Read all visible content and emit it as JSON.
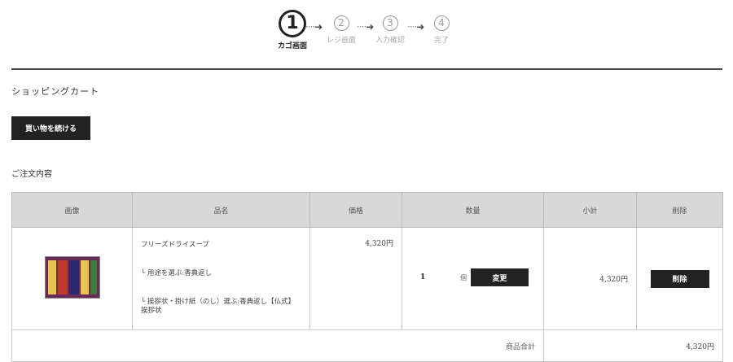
{
  "steps": [
    {
      "num": "1",
      "label": "カゴ画面"
    },
    {
      "num": "2",
      "label": "レジ画面"
    },
    {
      "num": "3",
      "label": "入力確認"
    },
    {
      "num": "4",
      "label": "完了"
    }
  ],
  "cart": {
    "heading": "ショッピングカート",
    "continue_label": "買い物を続ける",
    "order_heading": "ご注文内容"
  },
  "table": {
    "headers": [
      "画像",
      "品名",
      "価格",
      "数量",
      "小計",
      "削除"
    ],
    "rows": [
      {
        "name": "フリーズドライスープ",
        "option1": "└ 用途を選ぶ:香典返し",
        "option2": "└ 挨拶状・掛け紙（のし）選ぶ:香典返し【仏式】挨拶状",
        "price": "4,320円",
        "quantity": "1",
        "unit": "個",
        "change_label": "変更",
        "subtotal": "4,320円",
        "delete_label": "削除"
      }
    ],
    "total_label": "商品合計",
    "total_value": "4,320円"
  },
  "colors": {
    "button": "#222222",
    "header_bg": "#d8d8d8",
    "divider": "#444444"
  }
}
